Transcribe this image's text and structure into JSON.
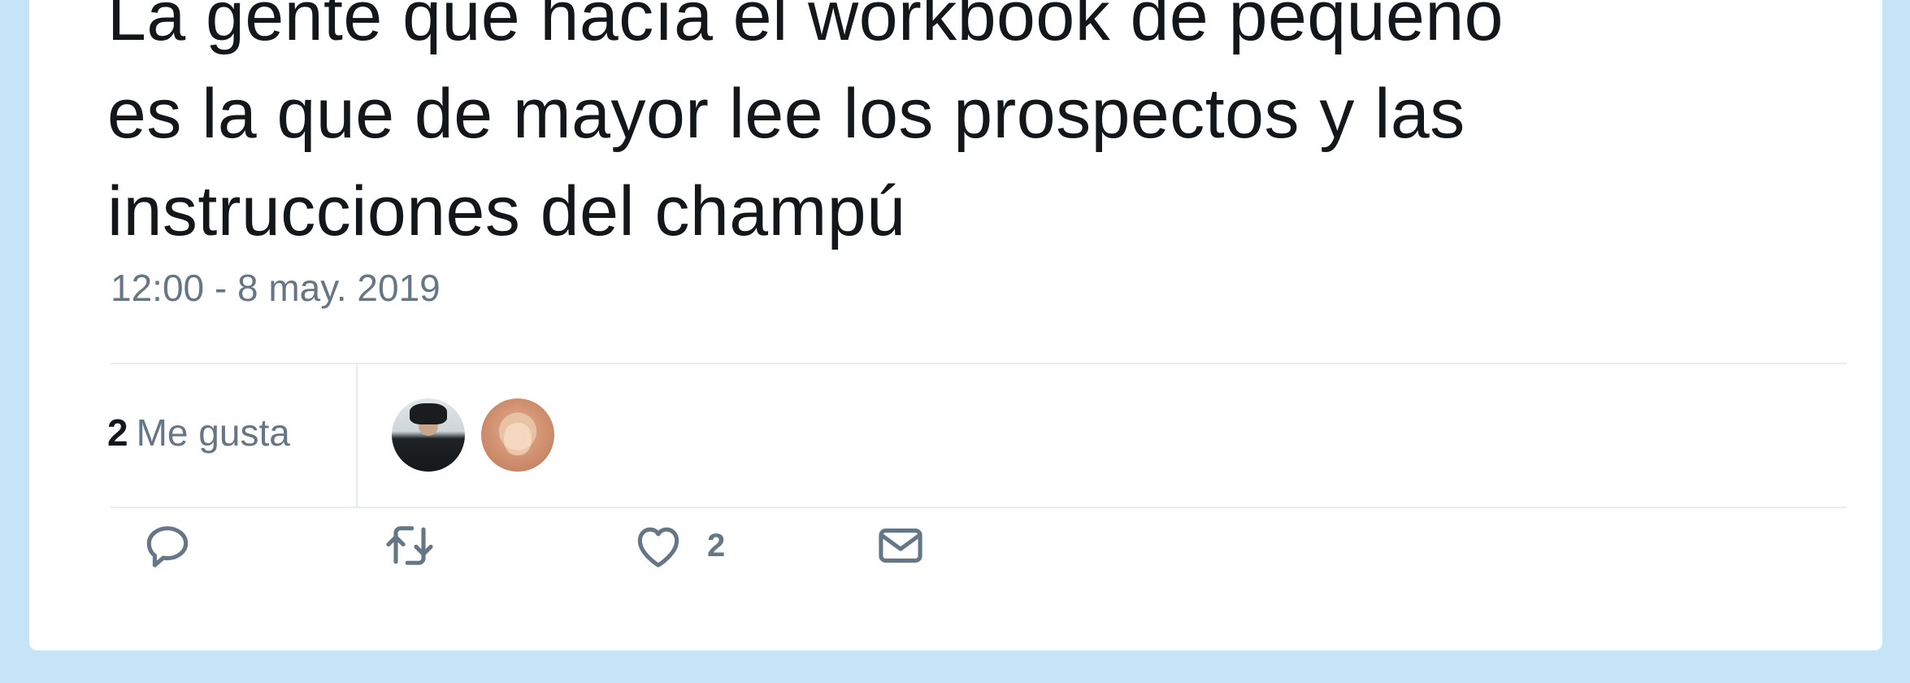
{
  "tweet": {
    "text_lines": [
      "La gente que hacía el workbook de pequeño",
      "es la que de mayor lee los prospectos y las",
      "instrucciones del champú"
    ],
    "timestamp": "12:00 - 8 may. 2019"
  },
  "likes": {
    "count": "2",
    "label": "Me gusta"
  },
  "actions": {
    "like_count": "2"
  },
  "colors": {
    "page_background": "#c6e4f8",
    "card_background": "#ffffff",
    "text_primary": "#14171a",
    "text_secondary": "#657786",
    "divider": "#e6ecf0"
  },
  "icons": {
    "reply": "reply-icon",
    "retweet": "retweet-icon",
    "like": "heart-icon",
    "direct_message": "mail-icon"
  }
}
